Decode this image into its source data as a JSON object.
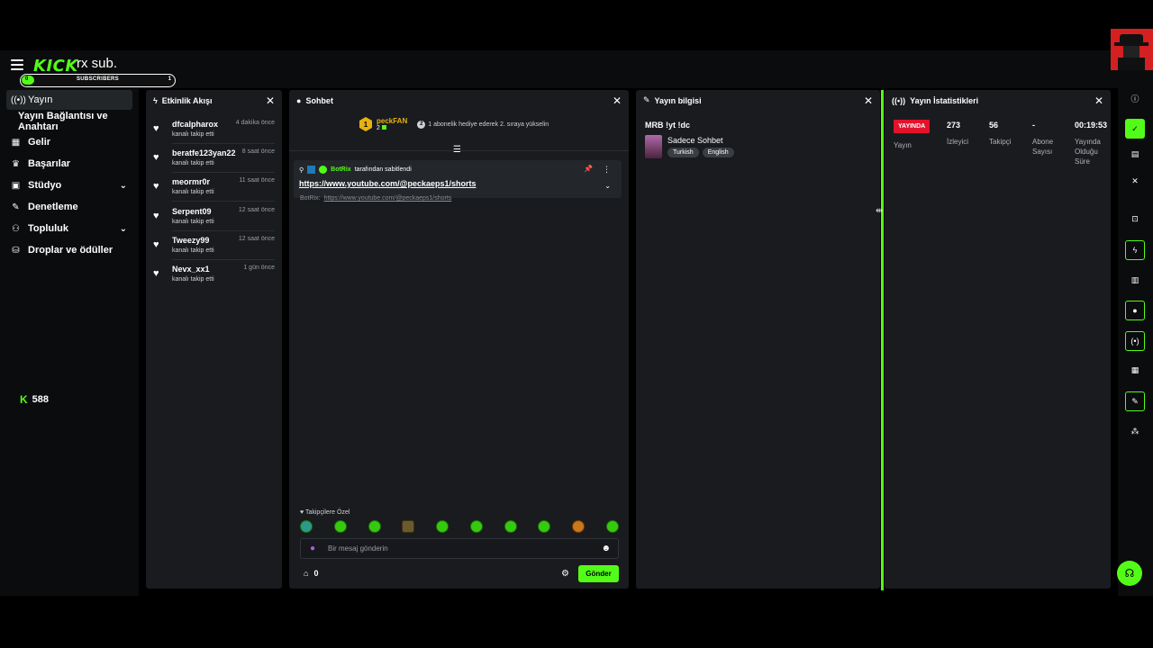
{
  "header": {
    "logo": "KICK",
    "logo_overlay": "rx sub.",
    "subs_bar": {
      "label": "SUBSCRIBERS",
      "current": "0",
      "goal": "1"
    }
  },
  "sidebar": {
    "items": [
      {
        "label": "Yayın",
        "icon": "broadcast-icon"
      },
      {
        "label": "Yayın Bağlantısı ve Anahtarı",
        "icon": ""
      },
      {
        "label": "Gelir",
        "icon": "chart-icon"
      },
      {
        "label": "Başarılar",
        "icon": "trophy-icon"
      },
      {
        "label": "Stüdyo",
        "icon": "studio-icon"
      },
      {
        "label": "Denetleme",
        "icon": "wrench-icon"
      },
      {
        "label": "Topluluk",
        "icon": "people-icon"
      },
      {
        "label": "Droplar ve ödüller",
        "icon": "gift-icon"
      }
    ],
    "coins": "588"
  },
  "activity": {
    "title": "Etkinlik Akışı",
    "events": [
      {
        "name": "dfcalpharox",
        "time": "4 dakika önce",
        "action": "kanalı takip etti"
      },
      {
        "name": "beratfe123yan22",
        "time": "8 saat önce",
        "action": "kanalı takip etti"
      },
      {
        "name": "meormr0r",
        "time": "11 saat önce",
        "action": "kanalı takip etti"
      },
      {
        "name": "Serpent09",
        "time": "12 saat önce",
        "action": "kanalı takip etti"
      },
      {
        "name": "Tweezy99",
        "time": "12 saat önce",
        "action": "kanalı takip etti"
      },
      {
        "name": "Nevx_xx1",
        "time": "1 gün önce",
        "action": "kanalı takip etti"
      }
    ]
  },
  "chat": {
    "title": "Sohbet",
    "top_gifter": {
      "rank": "1",
      "name": "peckFAN",
      "count": "2"
    },
    "gift_hint": "1 abonelik hediye ederek 2. sıraya yükselin",
    "pinned": {
      "by": "BotRix",
      "suffix": "tarafından sabitlendi",
      "link": "https://www.youtube.com/@peckaeps1/shorts"
    },
    "ghost_message": {
      "user": "BotRix:",
      "link": "https://www.youtube.com/@peckaeps1/shorts"
    },
    "follower_only": "Takipçilere Özel",
    "input_placeholder": "Bir mesaj gönderin",
    "points": "0",
    "send_label": "Gönder"
  },
  "stream_info": {
    "title": "Yayın bilgisi",
    "stream_title": "MRB !yt !dc",
    "category": "Sadece Sohbet",
    "tags": [
      "Turkish",
      "English"
    ]
  },
  "stats": {
    "title": "Yayın İstatistikleri",
    "status": "YAYINDA",
    "status_label": "Yayın",
    "viewers": {
      "value": "273",
      "label": "İzleyici"
    },
    "followers": {
      "value": "56",
      "label": "Takipçi"
    },
    "subscribers": {
      "value": "-",
      "label": "Abone Sayısı"
    },
    "uptime": {
      "value": "00:19:53",
      "label": "Yayında Olduğu Süre"
    }
  },
  "colors": {
    "accent": "#53fc18",
    "live": "#e3122b",
    "panel": "#191b1f",
    "background": "#000000"
  }
}
